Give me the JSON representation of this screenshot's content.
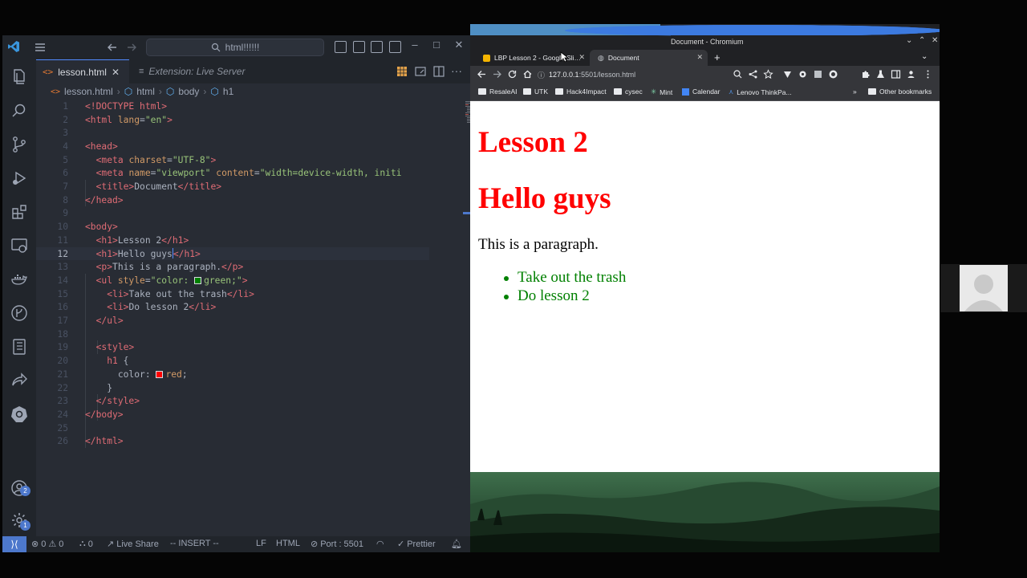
{
  "vscode": {
    "command_center": "html!!!!!!",
    "tabs": [
      {
        "label": "lesson.html",
        "active": true
      },
      {
        "label": "Extension: Live Server",
        "active": false
      }
    ],
    "tab_close": "✕",
    "breadcrumb": [
      "lesson.html",
      "html",
      "body",
      "h1"
    ],
    "badges": {
      "accounts": "2",
      "manage": "1"
    },
    "code_lines": [
      {
        "n": "1"
      },
      {
        "n": "2"
      },
      {
        "n": "3"
      },
      {
        "n": "4"
      },
      {
        "n": "5"
      },
      {
        "n": "6"
      },
      {
        "n": "7"
      },
      {
        "n": "8"
      },
      {
        "n": "9"
      },
      {
        "n": "10"
      },
      {
        "n": "11"
      },
      {
        "n": "12"
      },
      {
        "n": "13"
      },
      {
        "n": "14"
      },
      {
        "n": "15"
      },
      {
        "n": "16"
      },
      {
        "n": "17"
      },
      {
        "n": "18"
      },
      {
        "n": "19"
      },
      {
        "n": "20"
      },
      {
        "n": "21"
      },
      {
        "n": "22"
      },
      {
        "n": "23"
      },
      {
        "n": "24"
      },
      {
        "n": "25"
      },
      {
        "n": "26"
      }
    ],
    "code_text": {
      "l1": "<!DOCTYPE html>",
      "l2_tag": "<html",
      "l2_attr": "lang",
      "l2_val": "\"en\"",
      "l2_end": ">",
      "l4": "<head>",
      "l5_tag": "<meta",
      "l5_attr": "charset",
      "l5_val": "\"UTF-8\"",
      "l5_end": ">",
      "l6_tag": "<meta",
      "l6_attr": "name",
      "l6_val": "\"viewport\"",
      "l6_attr2": "content",
      "l6_val2": "\"width=device-width, initi",
      "l7_open": "<title>",
      "l7_text": "Document",
      "l7_close": "</title>",
      "l8": "</head>",
      "l10": "<body>",
      "l11_open": "<h1>",
      "l11_text": "Lesson 2",
      "l11_close": "</h1>",
      "l12_open": "<h1>",
      "l12_text": "Hello guys",
      "l12_close": "</h1>",
      "l13_open": "<p>",
      "l13_text": "This is a paragraph.",
      "l13_close": "</p>",
      "l14_tag": "<ul",
      "l14_attr": "style",
      "l14_val_a": "\"color: ",
      "l14_val_b": "green;\"",
      "l14_end": ">",
      "l15_open": "<li>",
      "l15_text": "Take out the trash",
      "l15_close": "</li>",
      "l16_open": "<li>",
      "l16_text": "Do lesson 2",
      "l16_close": "</li>",
      "l17": "</ul>",
      "l19": "<style>",
      "l20_sel": "h1",
      "l20_brace": " {",
      "l21_prop": "color",
      "l21_colon": ": ",
      "l21_val": "red",
      "l21_semi": ";",
      "l22": "}",
      "l23": "</style>",
      "l24": "</body>",
      "l26": "</html>"
    },
    "status": {
      "errors": "0",
      "warnings": "0",
      "ports": "0",
      "live_share": "Live Share",
      "mode": "-- INSERT --",
      "eol": "LF",
      "language": "HTML",
      "port": "Port : 5501",
      "prettier": "Prettier"
    },
    "colors": {
      "accent": "#4d78cc",
      "tag": "#e06c75",
      "attr": "#d19a66",
      "string": "#98c379"
    }
  },
  "chromium": {
    "window_title": "Document - Chromium",
    "tabs": [
      {
        "label": "LBP Lesson 2 - Google Sli…",
        "active": false
      },
      {
        "label": "Document",
        "active": true
      }
    ],
    "tab_close": "✕",
    "new_tab": "+",
    "url_host": "127.0.0.1",
    "url_path": ":5501/lesson.html",
    "bookmarks": [
      "ResaleAI",
      "UTK",
      "Hack4Impact",
      "cysec",
      "Mint",
      "Calendar",
      "Lenovo ThinkPa..."
    ],
    "bookmarks_overflow": "»",
    "other_bookmarks": "Other bookmarks"
  },
  "page": {
    "h1_1": "Lesson 2",
    "h1_2": "Hello guys",
    "paragraph": "This is a paragraph.",
    "list": [
      "Take out the trash",
      "Do lesson 2"
    ],
    "colors": {
      "h1": "#ff0000",
      "list": "#008000"
    }
  }
}
